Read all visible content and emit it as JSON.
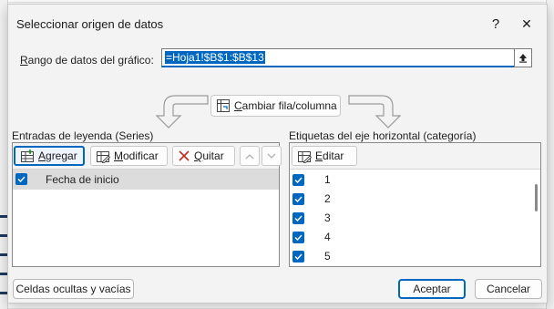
{
  "dialog": {
    "title": "Seleccionar origen de datos",
    "help_glyph": "?",
    "close_glyph": "✕"
  },
  "range": {
    "label_prefix": "R",
    "label_rest": "ango de datos del gráfico:",
    "value": "=Hoja1!$B$1:$B$13"
  },
  "switch_button": {
    "label_prefix": "C",
    "label_rest": "ambiar fila/columna"
  },
  "series_pane": {
    "title": "Entradas de leyenda (Series)",
    "buttons": [
      {
        "label_prefix": "A",
        "label_rest": "gregar"
      },
      {
        "label_prefix": "M",
        "label_rest": "odificar"
      },
      {
        "label_prefix": "Q",
        "label_rest": "uitar"
      }
    ],
    "items": [
      {
        "label": "Fecha de inicio",
        "checked": true
      }
    ]
  },
  "category_pane": {
    "title": "Etiquetas del eje horizontal (categoría)",
    "edit_prefix": "E",
    "edit_rest": "ditar",
    "items": [
      {
        "label": "1",
        "checked": true
      },
      {
        "label": "2",
        "checked": true
      },
      {
        "label": "3",
        "checked": true
      },
      {
        "label": "4",
        "checked": true
      },
      {
        "label": "5",
        "checked": true
      }
    ]
  },
  "footer": {
    "hidden_cells": "Celdas ocultas y vacías",
    "accept": "Aceptar",
    "cancel": "Cancelar"
  },
  "colors": {
    "accent": "#0067c0",
    "dialog_bg": "#f3f3f3",
    "selected_row": "#dcdcdc"
  }
}
